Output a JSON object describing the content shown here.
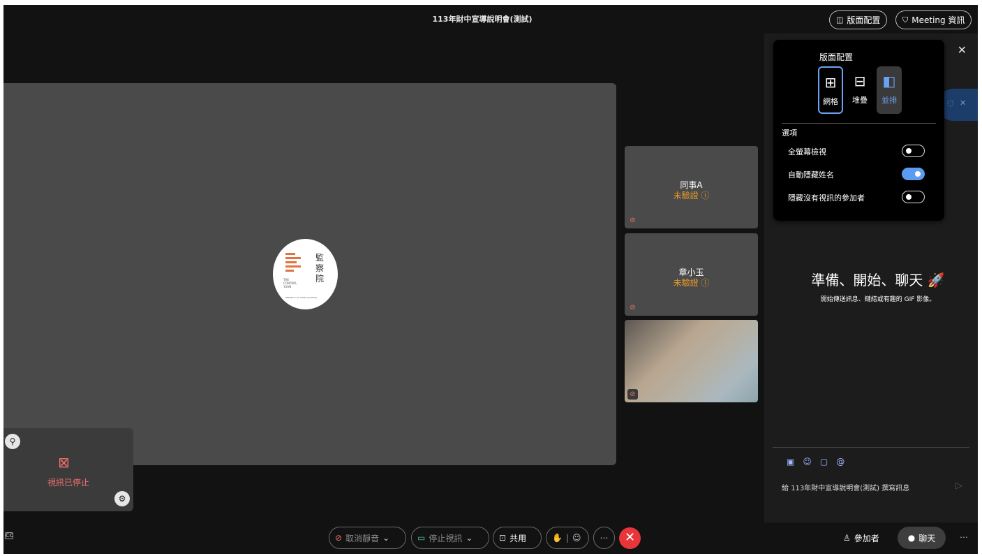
{
  "meeting": {
    "title": "113年財中宣導說明會(測試)"
  },
  "header": {
    "layout_label": "版面配置",
    "layout_icon": "layout-icon",
    "info_label": "Meeting 資訊",
    "info_icon": "shield-icon"
  },
  "stage": {
    "logo": {
      "cn_chars": [
        "監",
        "察",
        "院"
      ],
      "en_lines": [
        "THE",
        "CONTROL",
        "YUAN"
      ],
      "footer": "REPUBLIC OF CHINA (TAIWAN)"
    }
  },
  "participants": [
    {
      "name": "同事A",
      "status": "未驗證 ⓘ",
      "mic": "muted"
    },
    {
      "name": "章小玉",
      "status": "未驗證 ⓘ",
      "mic": "muted"
    },
    {
      "name": "",
      "status": "",
      "mic": "muted",
      "video": true
    }
  ],
  "self_view": {
    "status": "視訊已停止",
    "icon": "camera-off-icon"
  },
  "popover": {
    "title": "版面配置",
    "options": [
      {
        "label": "網格",
        "icon": "grid-icon",
        "selected": true
      },
      {
        "label": "堆疊",
        "icon": "stack-icon",
        "selected": false
      },
      {
        "label": "並排",
        "icon": "side-by-side-icon",
        "selected": false,
        "active": true
      }
    ],
    "section": "選項",
    "toggles": [
      {
        "label": "全螢幕檢視",
        "on": false
      },
      {
        "label": "自動隱藏姓名",
        "on": true
      },
      {
        "label": "隱藏沒有視訊的參加者",
        "on": false
      }
    ]
  },
  "chat": {
    "heading": "準備、開始、聊天 🚀",
    "subtext": "開始傳送訊息、鏈結或有趣的 GIF 影像。",
    "tools": [
      "markdown-icon",
      "emoji-icon",
      "file-icon",
      "mention-icon"
    ],
    "placeholder": "給 113年財中宣導說明會(測試) 撰寫訊息"
  },
  "controls": {
    "unmute": "取消靜音",
    "stop_video": "停止視訊",
    "share": "共用",
    "leave_icon": "close-icon"
  },
  "bottom_right": {
    "participants": "參加者",
    "chat": "聊天"
  },
  "colors": {
    "accent": "#6aa3f5",
    "leave": "#e8353a",
    "warning": "#e39a2a",
    "muted": "#f06f6f"
  }
}
